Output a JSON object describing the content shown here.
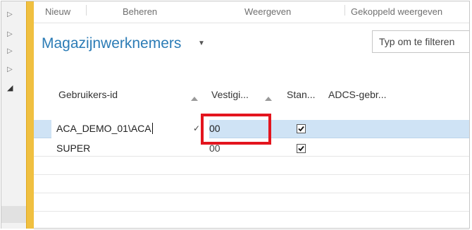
{
  "ribbon": {
    "tabs": [
      "Nieuw",
      "Beheren",
      "Weergeven",
      "Gekoppeld weergeven"
    ]
  },
  "page": {
    "title": "Magazijnwerknemers",
    "filter_placeholder": "Typ om te filteren"
  },
  "columns": [
    "Gebruikers-id",
    "Vestigi...",
    "Stan...",
    "ADCS-gebr..."
  ],
  "rows": [
    {
      "user_id": "ACA_DEMO_01\\ACA",
      "location": "00",
      "default": true,
      "selected": true
    },
    {
      "user_id": "SUPER",
      "location": "00",
      "default": true,
      "selected": false
    }
  ],
  "colors": {
    "title": "#2c7cb6",
    "selected_row": "#cfe3f5",
    "accent_bar": "#f0c040",
    "highlight": "#e3151e"
  }
}
